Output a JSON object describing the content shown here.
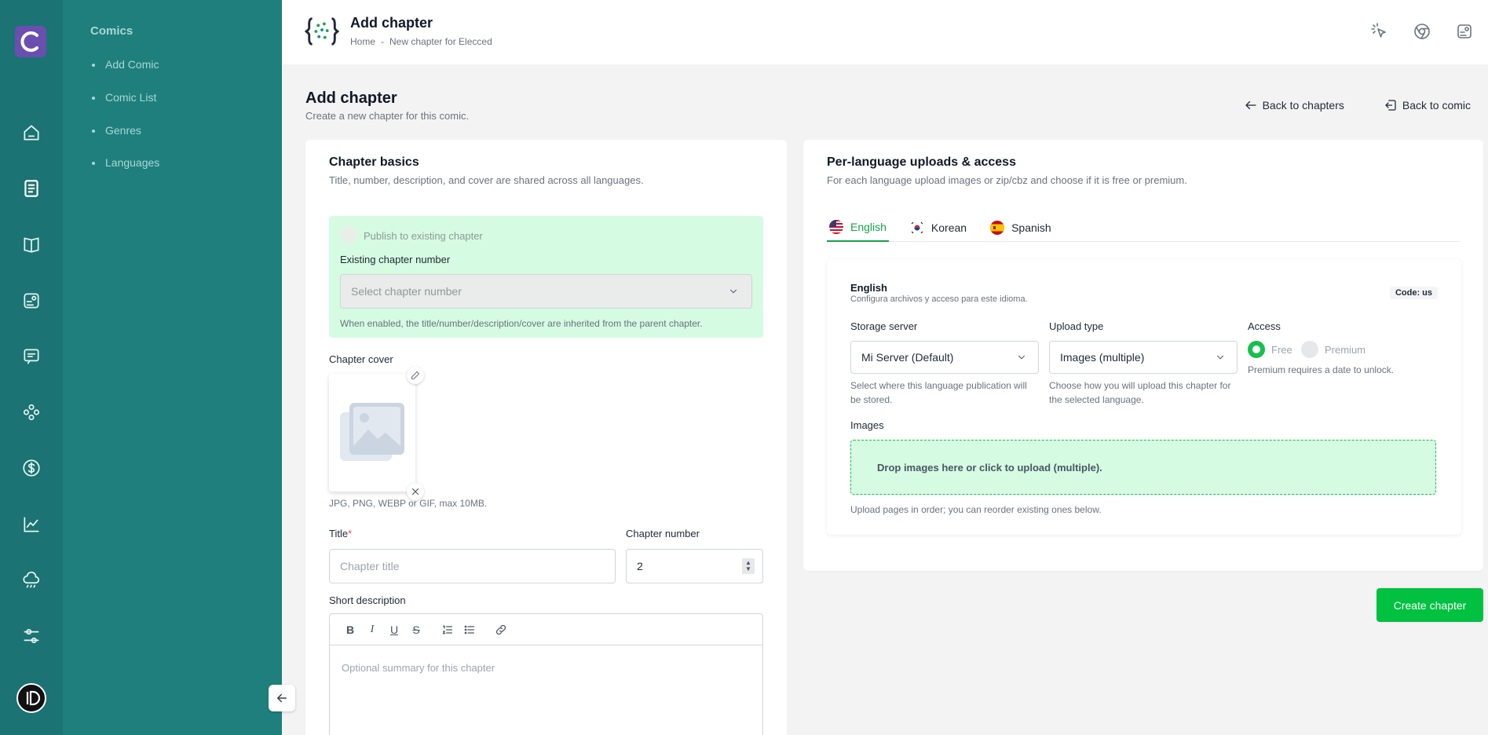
{
  "rail": {
    "logo_letter": "C",
    "icons": [
      "home-icon",
      "file-text-icon",
      "book-icon",
      "profile-card-icon",
      "message-icon",
      "users-icon",
      "dollar-icon",
      "chart-icon",
      "cloud-icon",
      "sliders-icon"
    ],
    "active_index": 1
  },
  "subnav": {
    "title": "Comics",
    "items": [
      {
        "label": "Add Comic"
      },
      {
        "label": "Comic List"
      },
      {
        "label": "Genres"
      },
      {
        "label": "Languages"
      }
    ]
  },
  "topbar": {
    "title": "Add chapter",
    "breadcrumb": {
      "home": "Home",
      "separator": "-",
      "current": "New chapter for Elecced"
    },
    "actions": [
      "pointer-icon",
      "chrome-icon",
      "profile-card-icon"
    ]
  },
  "page": {
    "title": "Add chapter",
    "subtitle": "Create a new chapter for this comic.",
    "back_to_chapters": "Back to chapters",
    "back_to_comic": "Back to comic"
  },
  "basics": {
    "title": "Chapter basics",
    "subtitle": "Title, number, description, and cover are shared across all languages.",
    "publish_existing_label": "Publish to existing chapter",
    "existing_number_label": "Existing chapter number",
    "existing_number_placeholder": "Select chapter number",
    "publish_help": "When enabled, the title/number/description/cover are inherited from the parent chapter.",
    "cover_label": "Chapter cover",
    "cover_help": "JPG, PNG, WEBP or GIF, max 10MB.",
    "title_label": "Title",
    "title_required": "*",
    "title_placeholder": "Chapter title",
    "number_label": "Chapter number",
    "number_value": "2",
    "description_label": "Short description",
    "description_placeholder": "Optional summary for this chapter",
    "toolbar": {
      "bold": "B",
      "italic": "I",
      "underline": "U",
      "strike": "S"
    }
  },
  "uploads": {
    "title": "Per-language uploads & access",
    "subtitle": "For each language upload images or zip/cbz and choose if it is free or premium.",
    "tabs": [
      {
        "label": "English",
        "flag": "us"
      },
      {
        "label": "Korean",
        "flag": "kr"
      },
      {
        "label": "Spanish",
        "flag": "es"
      }
    ],
    "active_tab": 0,
    "panel": {
      "title": "English",
      "subtitle": "Configura archivos y acceso para este idioma.",
      "code": "Code: us",
      "storage_label": "Storage server",
      "storage_value": "Mi Server (Default)",
      "storage_help": "Select where this language publication will be stored.",
      "upload_type_label": "Upload type",
      "upload_type_value": "Images (multiple)",
      "upload_type_help": "Choose how you will upload this chapter for the selected language.",
      "access_label": "Access",
      "access_free": "Free",
      "access_premium": "Premium",
      "access_selected": "Free",
      "access_help": "Premium requires a date to unlock.",
      "images_label": "Images",
      "dropzone_text": "Drop images here or click to upload (multiple).",
      "images_help": "Upload pages in order; you can reorder existing ones below."
    }
  },
  "actions": {
    "create": "Create chapter"
  },
  "colors": {
    "rail": "#1b7373",
    "subnav": "#1f7f7d",
    "accent": "#00c140",
    "soft_green": "#d5fbe2",
    "logo": "#6a4fb0"
  }
}
